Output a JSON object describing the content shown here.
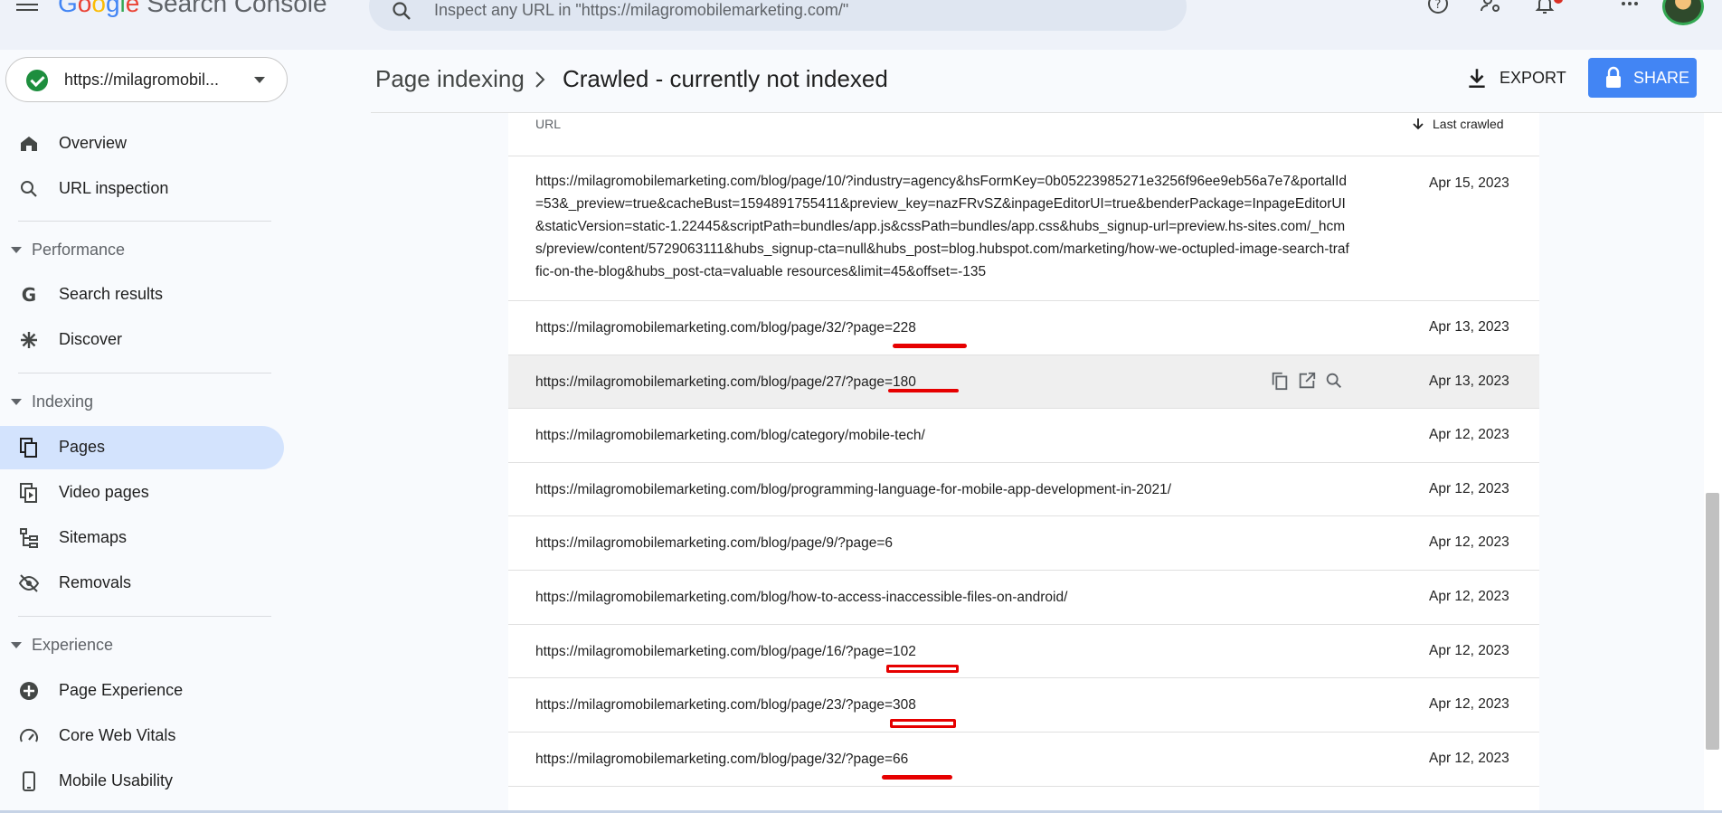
{
  "app": {
    "logo_word": [
      "G",
      "o",
      "o",
      "g",
      "l",
      "e"
    ],
    "product": "Search Console",
    "search_placeholder": "Inspect any URL in \"https://milagromobilemarketing.com/\""
  },
  "property": {
    "label": "https://milagromobil..."
  },
  "nav": {
    "overview": "Overview",
    "url_inspection": "URL inspection",
    "performance": "Performance",
    "search_results": "Search results",
    "discover": "Discover",
    "indexing": "Indexing",
    "pages": "Pages",
    "video_pages": "Video pages",
    "sitemaps": "Sitemaps",
    "removals": "Removals",
    "experience": "Experience",
    "page_experience": "Page Experience",
    "core_web_vitals": "Core Web Vitals",
    "mobile_usability": "Mobile Usability"
  },
  "header": {
    "crumb_parent": "Page indexing",
    "crumb_current": "Crawled - currently not indexed",
    "export_label": "EXPORT",
    "share_label": "SHARE"
  },
  "table": {
    "col_url": "URL",
    "col_date": "Last crawled",
    "rows": [
      {
        "url": "https://milagromobilemarketing.com/blog/page/10/?industry=agency&hsFormKey=0b05223985271e3256f96ee9eb56a7e7&portalId=53&_preview=true&cacheBust=1594891755411&preview_key=nazFRvSZ&inpageEditorUI=true&benderPackage=InpageEditorUI&staticVersion=static-1.22445&scriptPath=bundles/app.js&cssPath=bundles/app.css&hubs_signup-url=preview.hs-sites.com/_hcms/preview/content/5729063111&hubs_signup-cta=null&hubs_post=blog.hubspot.com/marketing/how-we-octupled-image-search-traffic-on-the-blog&hubs_post-cta=valuable resources&limit=45&offset=-135",
        "date": "Apr 15, 2023"
      },
      {
        "url": "https://milagromobilemarketing.com/blog/page/32/?page=228",
        "date": "Apr 13, 2023"
      },
      {
        "url": "https://milagromobilemarketing.com/blog/page/27/?page=180",
        "date": "Apr 13, 2023"
      },
      {
        "url": "https://milagromobilemarketing.com/blog/category/mobile-tech/",
        "date": "Apr 12, 2023"
      },
      {
        "url": "https://milagromobilemarketing.com/blog/programming-language-for-mobile-app-development-in-2021/",
        "date": "Apr 12, 2023"
      },
      {
        "url": "https://milagromobilemarketing.com/blog/page/9/?page=6",
        "date": "Apr 12, 2023"
      },
      {
        "url": "https://milagromobilemarketing.com/blog/how-to-access-inaccessible-files-on-android/",
        "date": "Apr 12, 2023"
      },
      {
        "url": "https://milagromobilemarketing.com/blog/page/16/?page=102",
        "date": "Apr 12, 2023"
      },
      {
        "url": "https://milagromobilemarketing.com/blog/page/23/?page=308",
        "date": "Apr 12, 2023"
      },
      {
        "url": "https://milagromobilemarketing.com/blog/page/32/?page=66",
        "date": "Apr 12, 2023"
      }
    ]
  },
  "icons": {
    "menu": "hamburger-icon",
    "search": "search-icon",
    "help": "help-icon",
    "settings": "manage-accounts-icon",
    "notifications": "bell-icon",
    "apps": "apps-grid-icon",
    "row_actions": [
      "copy-icon",
      "open-in-new-icon",
      "inspect-url-icon"
    ]
  },
  "colors": {
    "accent": "#4285f4",
    "active_nav": "#d3e3fd",
    "annotation_red": "#e60000",
    "verified_green": "#1e8e3e"
  }
}
